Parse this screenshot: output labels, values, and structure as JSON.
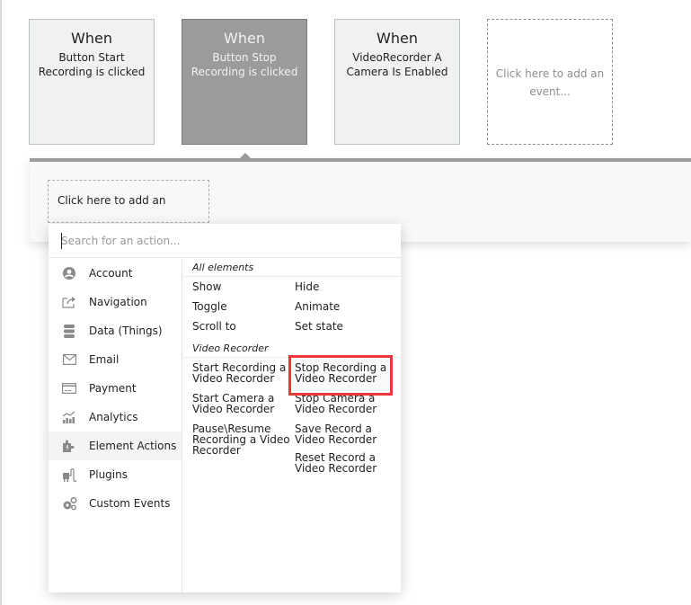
{
  "events": [
    {
      "when": "When",
      "description": "Button Start Recording is clicked",
      "selected": false
    },
    {
      "when": "When",
      "description": "Button Stop Recording is clicked",
      "selected": true
    },
    {
      "when": "When",
      "description": "VideoRecorder A Camera Is Enabled",
      "selected": false
    }
  ],
  "add_event_label": "Click here to add an event...",
  "add_action_label": "Click here to add an action...",
  "search": {
    "placeholder": "Search for an action...",
    "value": ""
  },
  "categories": [
    {
      "label": "Account",
      "icon": "account-icon"
    },
    {
      "label": "Navigation",
      "icon": "navigation-icon"
    },
    {
      "label": "Data (Things)",
      "icon": "database-icon"
    },
    {
      "label": "Email",
      "icon": "email-icon"
    },
    {
      "label": "Payment",
      "icon": "payment-card-icon"
    },
    {
      "label": "Analytics",
      "icon": "analytics-icon"
    },
    {
      "label": "Element Actions",
      "icon": "puzzle-icon",
      "active": true
    },
    {
      "label": "Plugins",
      "icon": "plug-icon"
    },
    {
      "label": "Custom Events",
      "icon": "gears-icon"
    }
  ],
  "all_elements": {
    "title": "All elements",
    "items": [
      "Show",
      "Hide",
      "Toggle",
      "Animate",
      "Scroll to",
      "Set state"
    ]
  },
  "video_recorder": {
    "title": "Video Recorder",
    "items": [
      "Start Recording a Video Recorder",
      "Stop Recording a Video Recorder",
      "Start Camera a Video Recorder",
      "Stop Camera a Video Recorder",
      "Pause\\Resume Recording a Video Recorder",
      "Save Record a Video Recorder",
      "",
      "Reset Record a Video Recorder"
    ],
    "highlighted": "Stop Recording a Video Recorder"
  },
  "colors": {
    "highlight": "#e8383a",
    "selected_event": "#9b9b9b"
  }
}
